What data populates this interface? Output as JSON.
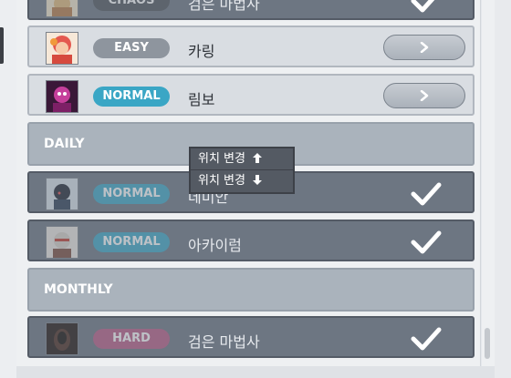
{
  "colors": {
    "easy": "#8e959e",
    "normal": "#3aa6c5",
    "hard": "#b85a84",
    "chaos": "#4d535b"
  },
  "bosses": [
    {
      "badge": "CHAOS",
      "name": "검은 마법사",
      "state": "done"
    },
    {
      "badge": "EASY",
      "name": "카링",
      "state": "available"
    },
    {
      "badge": "NORMAL",
      "name": "림보",
      "state": "available"
    }
  ],
  "daily": {
    "label": "DAILY",
    "bosses": [
      {
        "badge": "NORMAL",
        "name": "데미안",
        "state": "done"
      },
      {
        "badge": "NORMAL",
        "name": "아카이럼",
        "state": "done"
      }
    ]
  },
  "monthly": {
    "label": "MONTHLY",
    "bosses": [
      {
        "badge": "HARD",
        "name": "검은 마법사",
        "state": "done"
      }
    ]
  },
  "context_menu": {
    "move_up": "위치 변경",
    "move_down": "위치 변경"
  }
}
